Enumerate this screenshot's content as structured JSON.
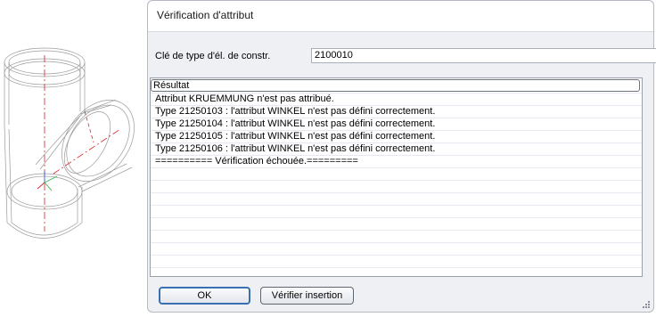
{
  "dialog": {
    "title": "Vérification d'attribut",
    "key_label": "Clé de type d'él. de constr.",
    "key_value": "2100010",
    "result_header": "Résultat",
    "result_lines": [
      "Attribut KRUEMMUNG n'est pas attribué.",
      "Type 21250103 : l'attribut WINKEL n'est pas défini correctement.",
      "Type 21250104 : l'attribut WINKEL n'est pas défini correctement.",
      "Type 21250105 : l'attribut WINKEL n'est pas défini correctement.",
      "Type 21250106 : l'attribut WINKEL n'est pas défini correctement.",
      "========== Vérification échouée.========="
    ],
    "ok_label": "OK",
    "verify_label": "Vérifier insertion"
  },
  "colors": {
    "dialog_bg": "#eef0f4",
    "axis_red": "#d9242a",
    "axis_green": "#2fb34a",
    "axis_blue": "#2f5fd9"
  }
}
